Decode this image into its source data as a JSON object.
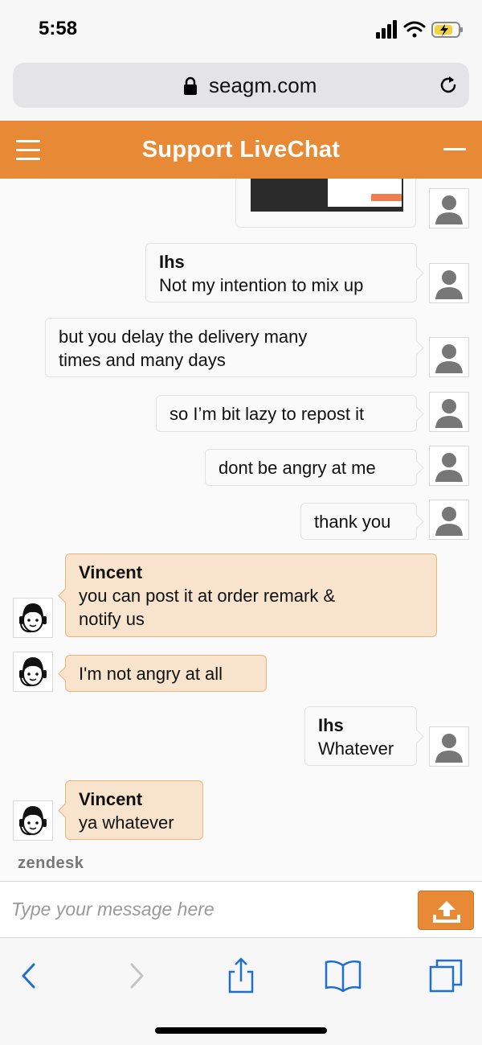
{
  "status_bar": {
    "time": "5:58"
  },
  "browser": {
    "url": "seagm.com"
  },
  "header": {
    "title": "Support LiveChat"
  },
  "messages": [
    {
      "sender": "Ihs",
      "text": "Not my intention to mix up"
    },
    {
      "text_line1": "but you delay the delivery many",
      "text_line2": "times and many days"
    },
    {
      "text": "so I’m bit lazy to repost it"
    },
    {
      "text": "dont be angry at me"
    },
    {
      "text": "thank you"
    },
    {
      "sender": "Vincent",
      "text_line1": "you can post it at order remark &",
      "text_line2": "notify us"
    },
    {
      "text": "I'm not angry at all"
    },
    {
      "sender": "Ihs",
      "text": "Whatever"
    },
    {
      "sender": "Vincent",
      "text": "ya whatever"
    }
  ],
  "footer": {
    "brand": "zendesk"
  },
  "input": {
    "placeholder": "Type your message here"
  },
  "colors": {
    "accent": "#e88a35",
    "agent_bubble": "#f8e3cc",
    "ios_blue": "#1f6fd1"
  }
}
